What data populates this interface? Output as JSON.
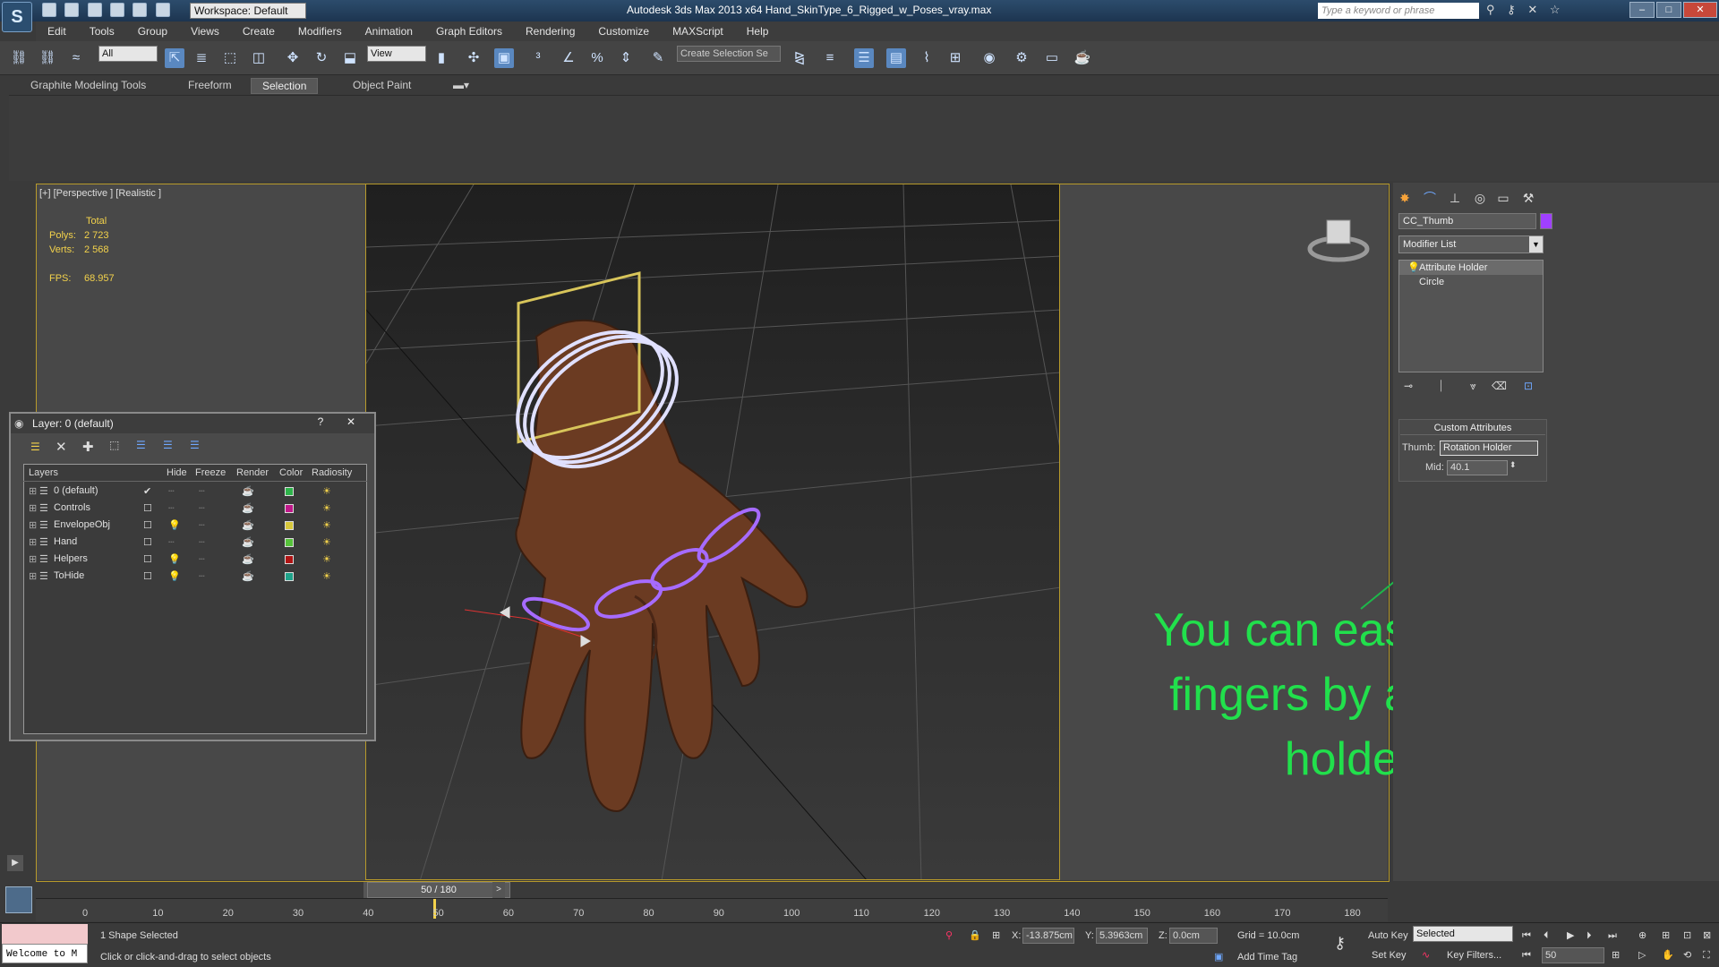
{
  "window": {
    "workspace": "Workspace: Default",
    "title": "Autodesk 3ds Max  2013 x64      Hand_SkinType_6_Rigged_w_Poses_vray.max",
    "search_placeholder": "Type a keyword or phrase"
  },
  "menu": [
    "Edit",
    "Tools",
    "Group",
    "Views",
    "Create",
    "Modifiers",
    "Animation",
    "Graph Editors",
    "Rendering",
    "Customize",
    "MAXScript",
    "Help"
  ],
  "toolbar": {
    "selection_filter": "All",
    "reference_coord": "View",
    "named_selection": "Create Selection Se"
  },
  "ribbon": {
    "tabs": [
      "Graphite Modeling Tools",
      "Freeform",
      "Selection",
      "Object Paint"
    ],
    "active_tab": "Selection"
  },
  "viewport": {
    "label": "[+] [Perspective ] [Realistic ]",
    "stats": {
      "total_label": "Total",
      "polys_label": "Polys:",
      "polys_value": "2 723",
      "verts_label": "Verts:",
      "verts_value": "2 568",
      "fps_label": "FPS:",
      "fps_value": "68.957"
    },
    "annotation": "You can easily bend fingers by attribute holders"
  },
  "command_panel": {
    "object_name": "CC_Thumb",
    "object_color": "#a040ff",
    "modifier_list": "Modifier List",
    "stack": [
      "Attribute Holder",
      "Circle"
    ],
    "rollout_title": "Custom Attributes",
    "thumb_label": "Thumb:",
    "thumb_value": "Rotation Holder",
    "mid_label": "Mid:",
    "mid_value": "40.1"
  },
  "layer_dialog": {
    "title": "Layer: 0 (default)",
    "columns": [
      "Layers",
      "Hide",
      "Freeze",
      "Render",
      "Color",
      "Radiosity"
    ],
    "rows": [
      {
        "name": "0 (default)",
        "color": "#2eb34a",
        "hidden": false,
        "active": true
      },
      {
        "name": "Controls",
        "color": "#c0188a",
        "hidden": false,
        "active": false
      },
      {
        "name": "EnvelopeObj",
        "color": "#d7c83c",
        "hidden": true,
        "active": false
      },
      {
        "name": "Hand",
        "color": "#56c23a",
        "hidden": false,
        "active": false
      },
      {
        "name": "Helpers",
        "color": "#b01414",
        "hidden": true,
        "active": false
      },
      {
        "name": "ToHide",
        "color": "#1fa38a",
        "hidden": true,
        "active": false
      }
    ]
  },
  "timeline": {
    "position": "50 / 180",
    "ticks": [
      "0",
      "10",
      "20",
      "30",
      "40",
      "50",
      "60",
      "70",
      "80",
      "90",
      "100",
      "110",
      "120",
      "130",
      "140",
      "150",
      "160",
      "170",
      "180"
    ]
  },
  "status": {
    "maxscript": "Welcome to M",
    "selection": "1 Shape Selected",
    "prompt": "Click or click-and-drag to select objects",
    "x_label": "X:",
    "x_value": "-13.875cm",
    "y_label": "Y:",
    "y_value": "5.3963cm",
    "z_label": "Z:",
    "z_value": "0.0cm",
    "grid": "Grid = 10.0cm",
    "add_time_tag": "Add Time Tag",
    "auto_key": "Auto Key",
    "set_key": "Set Key",
    "key_mode": "Selected",
    "key_filters": "Key Filters...",
    "frame": "50"
  }
}
